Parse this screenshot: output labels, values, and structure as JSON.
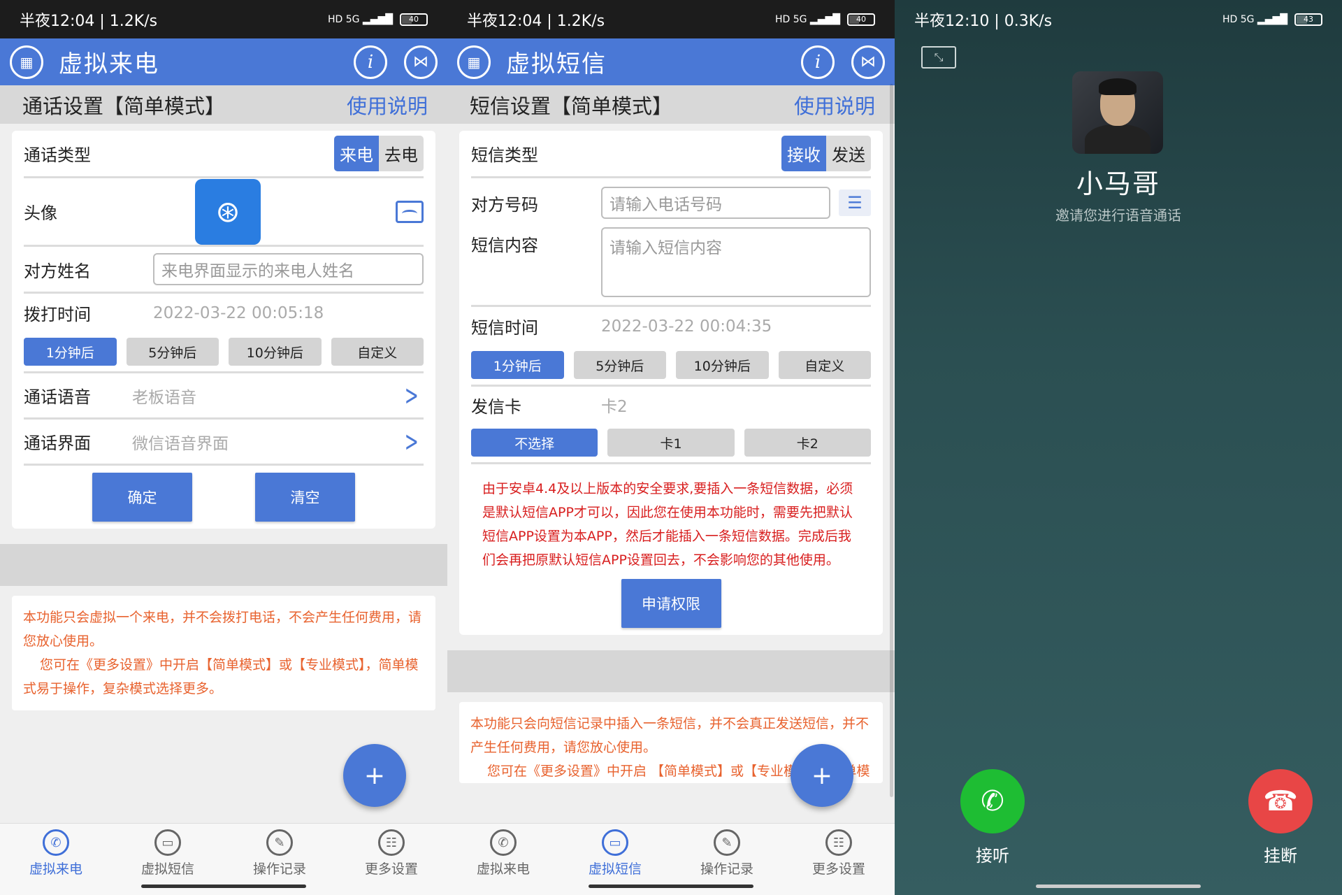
{
  "panel1": {
    "status": {
      "left": "半夜12:04 | 1.2K/s",
      "battery": "40"
    },
    "appbar": {
      "title": "虚拟来电",
      "logo_icon": "app-logo-icon",
      "info_icon": "info-icon",
      "share_icon": "share-icon"
    },
    "subbar": {
      "title": "通话设置【简单模式】",
      "help": "使用说明"
    },
    "call_type": {
      "label": "通话类型",
      "options": [
        "来电",
        "去电"
      ],
      "selected": "来电"
    },
    "avatar": {
      "label": "头像"
    },
    "name": {
      "label": "对方姓名",
      "placeholder": "来电界面显示的来电人姓名"
    },
    "dial_time": {
      "label": "拨打时间",
      "value": "2022-03-22 00:05:18"
    },
    "time_buttons": [
      "1分钟后",
      "5分钟后",
      "10分钟后",
      "自定义"
    ],
    "voice": {
      "label": "通话语音",
      "value": "老板语音"
    },
    "interface": {
      "label": "通话界面",
      "value": "微信语音界面"
    },
    "confirm": "确定",
    "clear": "清空",
    "note_line1": "本功能只会虚拟一个来电，并不会拨打电话，不会产生任何费用，请您放心使用。",
    "note_line2": "您可在《更多设置》中开启【简单模式】或【专业模式】，简单模式易于操作，复杂模式选择更多。",
    "fab": "+"
  },
  "panel2": {
    "status": {
      "left": "半夜12:04 | 1.2K/s",
      "battery": "40"
    },
    "appbar": {
      "title": "虚拟短信"
    },
    "subbar": {
      "title": "短信设置【简单模式】",
      "help": "使用说明"
    },
    "sms_type": {
      "label": "短信类型",
      "options": [
        "接收",
        "发送"
      ],
      "selected": "接收"
    },
    "number": {
      "label": "对方号码",
      "placeholder": "请输入电话号码"
    },
    "content": {
      "label": "短信内容",
      "placeholder": "请输入短信内容"
    },
    "sms_time": {
      "label": "短信时间",
      "value": "2022-03-22 00:04:35"
    },
    "time_buttons": [
      "1分钟后",
      "5分钟后",
      "10分钟后",
      "自定义"
    ],
    "card": {
      "label": "发信卡",
      "value": "卡2",
      "options": [
        "不选择",
        "卡1",
        "卡2"
      ]
    },
    "warning": "由于安卓4.4及以上版本的安全要求,要插入一条短信数据，必须是默认短信APP才可以，因此您在使用本功能时，需要先把默认短信APP设置为本APP，然后才能插入一条短信数据。完成后我们会再把原默认短信APP设置回去，不会影响您的其他使用。",
    "request": "申请权限",
    "note_line1": "本功能只会向短信记录中插入一条短信，并不会真正发送短信，并不产生任何费用，请您放心使用。",
    "note_line2": "您可在《更多设置》中开启 【简单模式】或【专业模式】，简单模式易于操作，复杂模式选择更多。",
    "fab": "+"
  },
  "nav": [
    {
      "label": "虚拟来电",
      "icon": "phone-icon"
    },
    {
      "label": "虚拟短信",
      "icon": "message-icon"
    },
    {
      "label": "操作记录",
      "icon": "edit-icon"
    },
    {
      "label": "更多设置",
      "icon": "settings-icon"
    }
  ],
  "panel3": {
    "status": {
      "left": "半夜12:10 | 0.3K/s",
      "battery": "43"
    },
    "caller_name": "小马哥",
    "caller_sub": "邀请您进行语音通话",
    "answer": "接听",
    "hangup": "挂断"
  },
  "colors": {
    "accent": "#4a78d6",
    "warning": "#d81e1e",
    "note": "#e8622e",
    "answer": "#1ebd33",
    "hangup": "#e84646"
  }
}
